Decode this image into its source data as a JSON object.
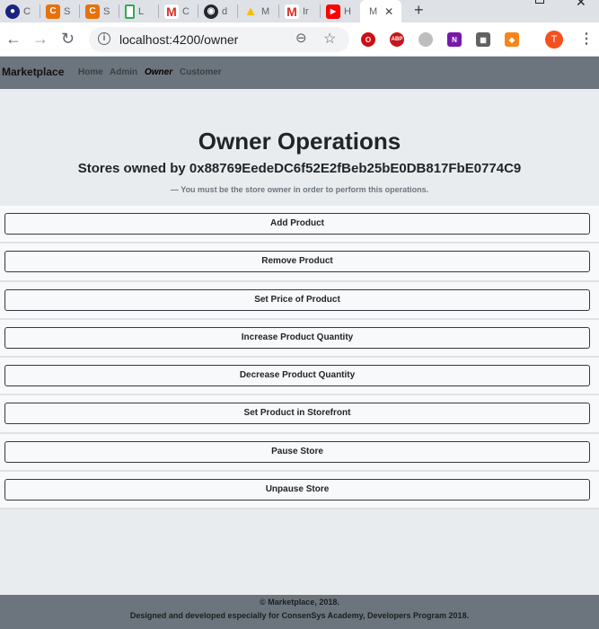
{
  "browser": {
    "tabs": [
      {
        "icon": "circle-logo-icon",
        "title": "C",
        "color": "#1a237e"
      },
      {
        "icon": "c-logo-icon",
        "title": "S",
        "color": "#e8710a"
      },
      {
        "icon": "c-logo-icon",
        "title": "S",
        "color": "#e8710a"
      },
      {
        "icon": "phone-icon",
        "title": "L",
        "color": "#34a853"
      },
      {
        "icon": "gmail-icon",
        "title": "C",
        "color": "#d93025"
      },
      {
        "icon": "github-icon",
        "title": "d",
        "color": "#24292e"
      },
      {
        "icon": "drive-icon",
        "title": "M",
        "color": "#fbbc04"
      },
      {
        "icon": "gmail-icon",
        "title": "Ir",
        "color": "#d93025"
      },
      {
        "icon": "youtube-icon",
        "title": "H",
        "color": "#ff0000"
      }
    ],
    "active_tab": {
      "title": "M",
      "close": "✕"
    },
    "new_tab": "+",
    "url": "localhost:4200/owner",
    "profile_initial": "T"
  },
  "app": {
    "brand": "Marketplace",
    "nav": {
      "home": "Home",
      "admin": "Admin",
      "owner": "Owner",
      "customer": "Customer"
    }
  },
  "header": {
    "title": "Owner Operations",
    "subtitle": "Stores owned by 0x88769EedeDC6f52E2fBeb25bE0DB817FbE0774C9",
    "note": "— You must be the store owner in order to perform this operations."
  },
  "operations": {
    "add_product": "Add Product",
    "remove_product": "Remove Product",
    "set_price": "Set Price of Product",
    "increase_quantity": "Increase Product Quantity",
    "decrease_quantity": "Decrease Product Quantity",
    "set_storefront": "Set Product in Storefront",
    "pause_store": "Pause Store",
    "unpause_store": "Unpause Store"
  },
  "footer": {
    "line1": "© Marketplace, 2018.",
    "line2": "Designed and developed especially for ConsenSys Academy, Developers Program 2018."
  },
  "colors": {
    "navbar": "#6c757d",
    "background": "#e9ecef",
    "button_border": "#343a40"
  }
}
